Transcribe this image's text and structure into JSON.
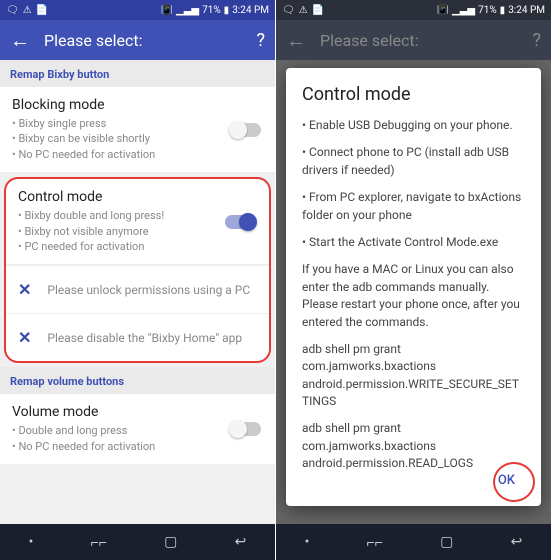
{
  "status": {
    "left_icons": [
      "🗨",
      "⚠",
      "📄"
    ],
    "right_icons": [
      "📶",
      "📶"
    ],
    "battery": "71%",
    "time": "3:24 PM"
  },
  "left": {
    "title": "Please select:",
    "help": "?",
    "section1": "Remap Bixby button",
    "blocking": {
      "title": "Blocking mode",
      "sub1": "• Bixby single press",
      "sub2": "• Bixby can be visible shortly",
      "sub3": "• No PC needed for activation"
    },
    "control": {
      "title": "Control mode",
      "sub1": "• Bixby double and long press!",
      "sub2": "• Bixby not visible anymore",
      "sub3": "• PC needed for activation",
      "perm1": "Please unlock permissions using a PC",
      "perm2": "Please disable the \"Bixby Home\" app"
    },
    "section2": "Remap volume buttons",
    "volume": {
      "title": "Volume mode",
      "sub1": "• Double and long press",
      "sub2": "• No PC needed for activation"
    }
  },
  "right": {
    "title": "Please select:",
    "help": "?",
    "dialog": {
      "title": "Control mode",
      "b1": "• Enable USB Debugging on your phone.",
      "b2": "• Connect phone to PC (install adb USB drivers if needed)",
      "b3": "• From PC explorer, navigate to bxActions folder on your phone",
      "b4": "• Start the Activate Control Mode.exe",
      "p1": "If you have a MAC or Linux you can also enter the adb commands manually. Please restart your phone once, after you entered the commands.",
      "cmd1": "adb shell pm grant com.jamworks.bxactions android.permission.WRITE_SECURE_SETTINGS",
      "cmd2": "adb shell pm grant com.jamworks.bxactions android.permission.READ_LOGS",
      "ok": "OK"
    }
  }
}
